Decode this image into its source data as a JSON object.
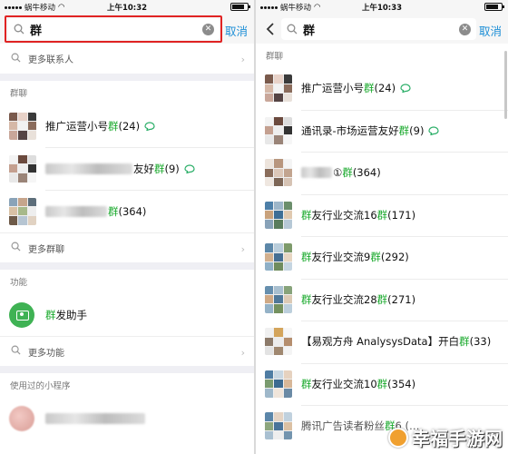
{
  "left": {
    "status": {
      "carrier": "蜗牛移动",
      "time": "上午10:32"
    },
    "search": {
      "query": "群",
      "cancel": "取消"
    },
    "more_contacts": "更多联系人",
    "group_section": {
      "title": "群聊",
      "items": [
        {
          "pre": "推广运营小号",
          "hl": "群",
          "post": " (24)"
        },
        {
          "pre": "",
          "hl": "",
          "post": "友好",
          "suffix_hl": "群",
          "suffix": " (9)"
        },
        {
          "pre": "",
          "hl": "群",
          "post": " (364)"
        }
      ],
      "more": "更多群聊"
    },
    "function_section": {
      "title": "功能",
      "item": {
        "hl": "群",
        "post": "发助手"
      },
      "more": "更多功能"
    },
    "mini_section": {
      "title": "使用过的小程序"
    }
  },
  "right": {
    "status": {
      "carrier": "蜗牛移动",
      "time": "上午10:33"
    },
    "search": {
      "query": "群",
      "cancel": "取消"
    },
    "group_section": {
      "title": "群聊",
      "items": [
        {
          "pre": "推广运营小号",
          "hl": "群",
          "post": " (24)"
        },
        {
          "pre": "通讯录-市场运营友好",
          "hl": "群",
          "post": " (9)"
        },
        {
          "pre": "①",
          "hl": "群",
          "post": " (364)"
        },
        {
          "pre": "",
          "hl": "群",
          "mid": "友行业交流16",
          "hl2": "群",
          "post": " (171)"
        },
        {
          "pre": "",
          "hl": "群",
          "mid": "友行业交流9",
          "hl2": "群",
          "post": " (292)"
        },
        {
          "pre": "",
          "hl": "群",
          "mid": "友行业交流28",
          "hl2": "群",
          "post": " (271)"
        },
        {
          "pre": "【易观方舟 AnalysysData】开白",
          "hl": "群",
          "post": " (33)"
        },
        {
          "pre": "",
          "hl": "群",
          "mid": "友行业交流10",
          "hl2": "群",
          "post": " (354)"
        },
        {
          "pre": "腾讯广告读者粉丝",
          "hl": "群",
          "post": "6 (…"
        }
      ]
    }
  },
  "watermark": "幸福手游网",
  "colors": {
    "highlight": "#17a82a",
    "cancel": "#1c8ed6",
    "frame": "#e02323",
    "section_bg": "#efeff4"
  }
}
